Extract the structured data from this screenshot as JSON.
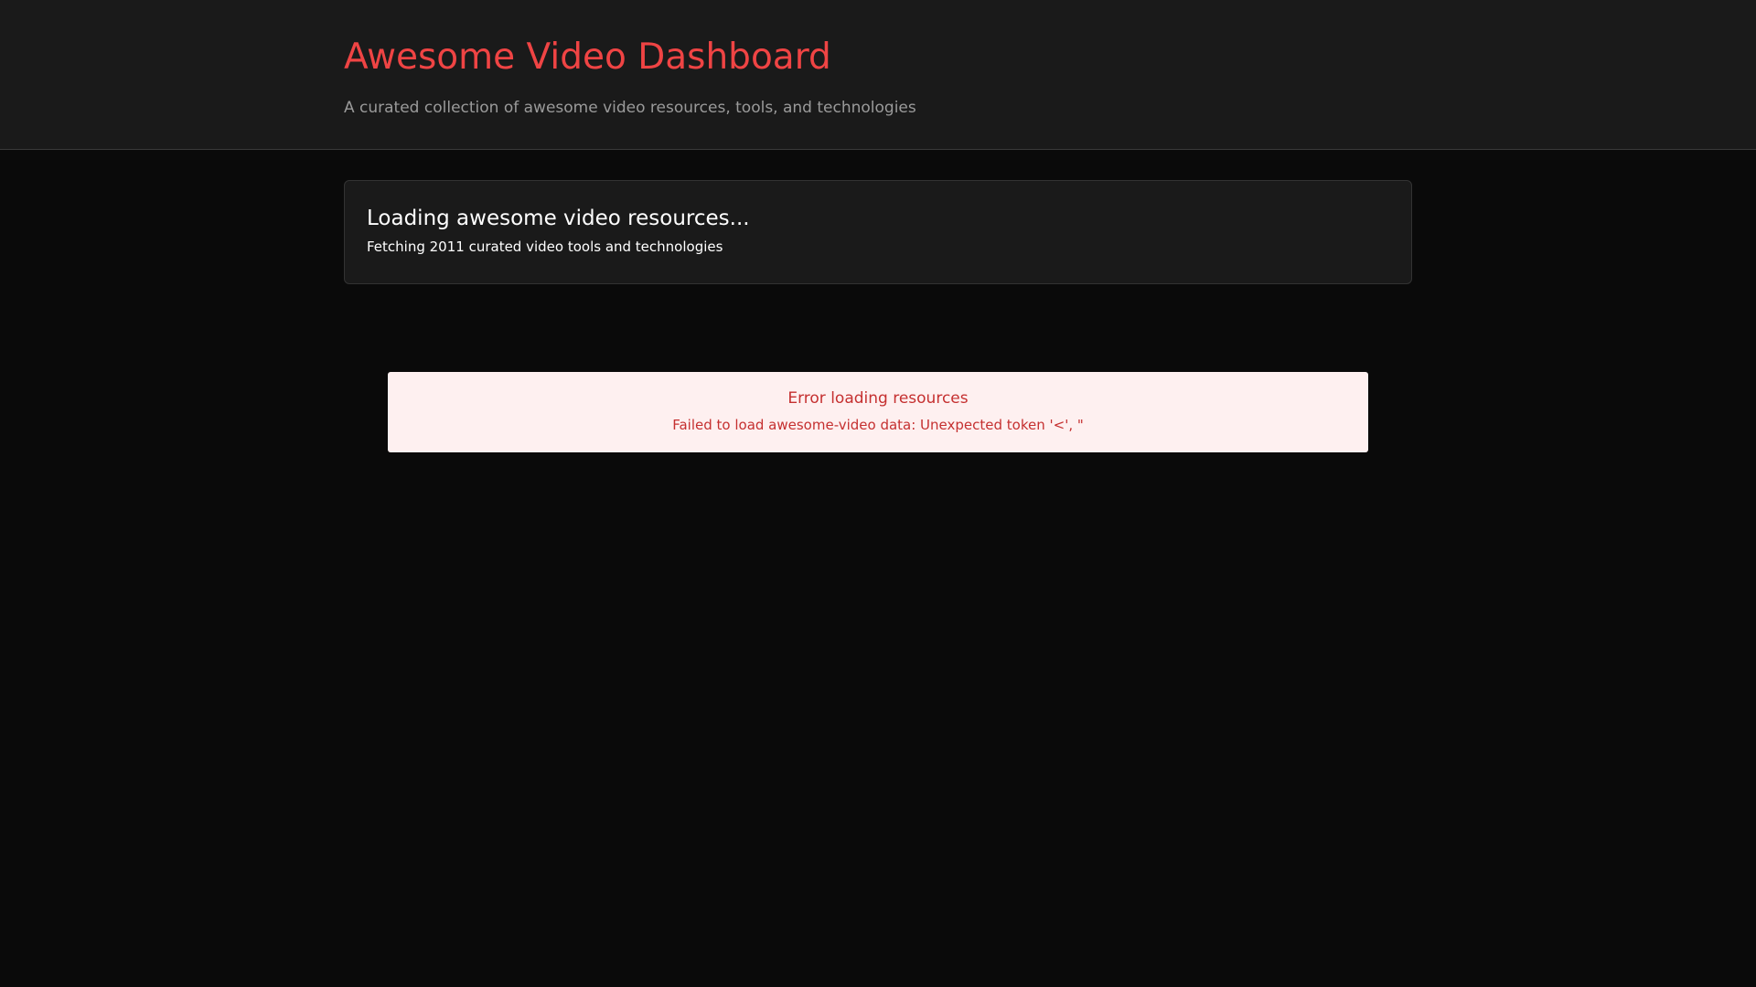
{
  "header": {
    "title": "Awesome Video Dashboard",
    "subtitle": "A curated collection of awesome video resources, tools, and technologies"
  },
  "loading": {
    "title": "Loading awesome video resources...",
    "subtitle": "Fetching 2011 curated video tools and technologies"
  },
  "error": {
    "title": "Error loading resources",
    "message": "Failed to load awesome-video data: Unexpected token '<', \""
  },
  "colors": {
    "page_background": "#0a0a0a",
    "header_background": "#1a1a1a",
    "accent": "#ef4444",
    "error_background": "#fef0f0",
    "error_text": "#c53030"
  }
}
